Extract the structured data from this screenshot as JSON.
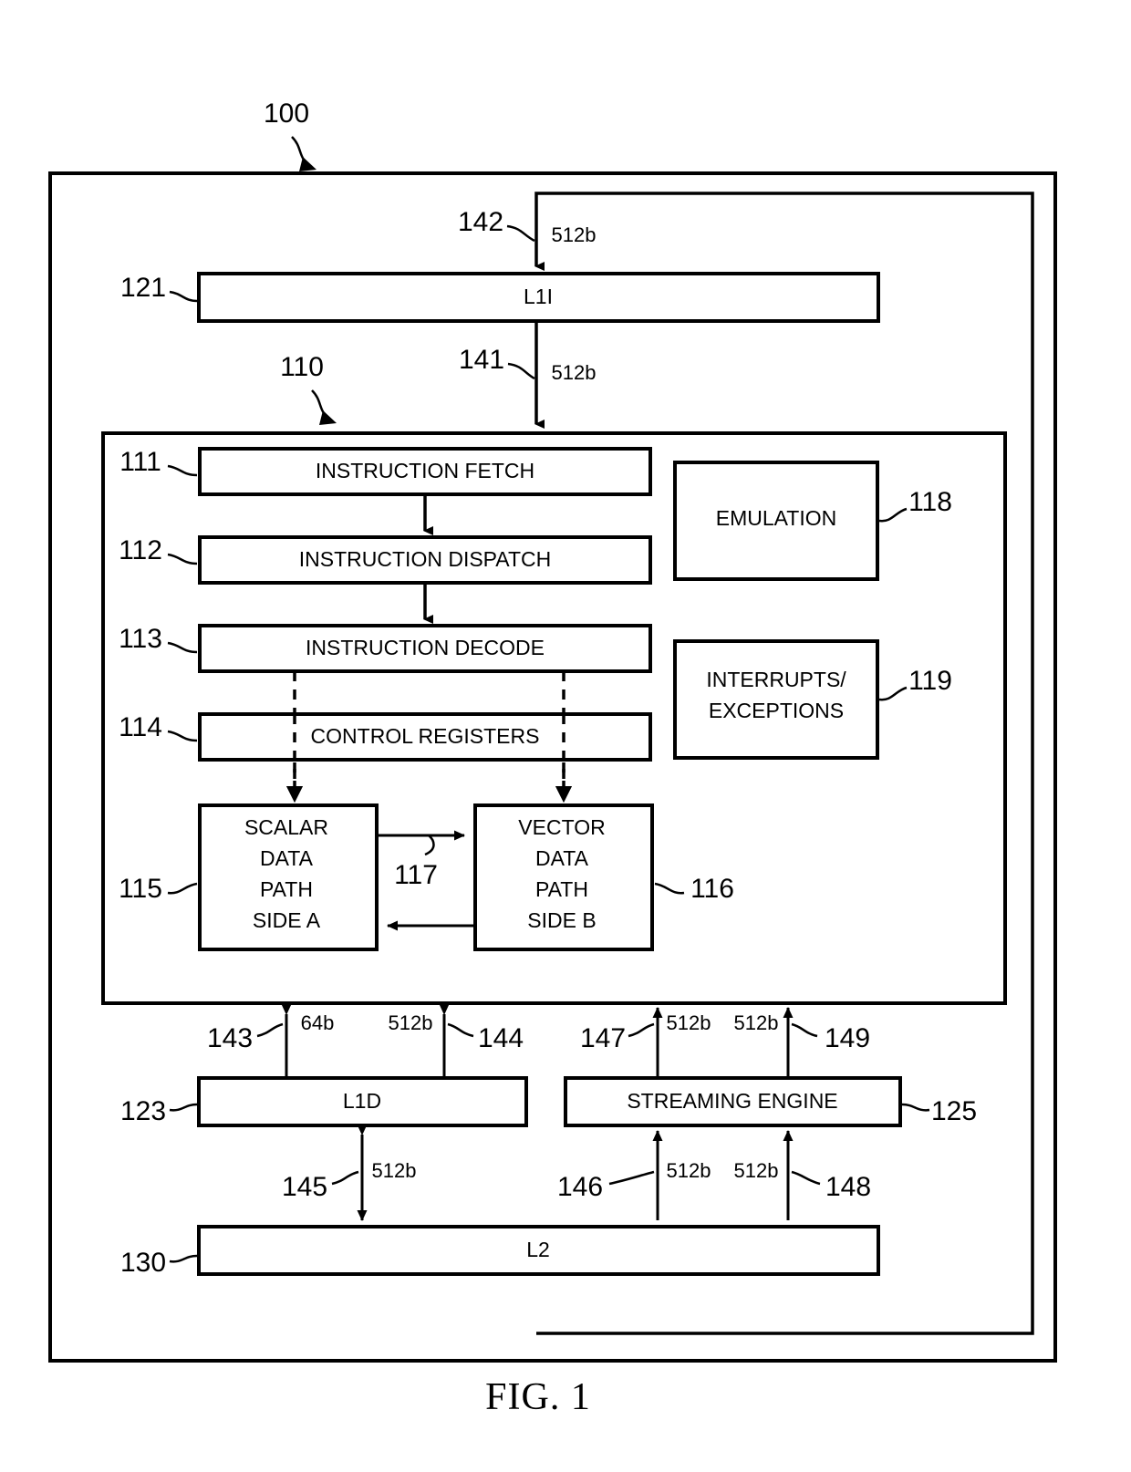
{
  "figure": {
    "caption": "FIG. 1",
    "system_ref": "100"
  },
  "blocks": {
    "l1i": {
      "label": "L1I",
      "ref": "121"
    },
    "cpu_core": {
      "ref": "110"
    },
    "instruction_fetch": {
      "label": "INSTRUCTION FETCH",
      "ref": "111"
    },
    "instruction_dispatch": {
      "label": "INSTRUCTION DISPATCH",
      "ref": "112"
    },
    "instruction_decode": {
      "label": "INSTRUCTION DECODE",
      "ref": "113"
    },
    "control_registers": {
      "label": "CONTROL REGISTERS",
      "ref": "114"
    },
    "scalar_data_path": {
      "label_lines": [
        "SCALAR",
        "DATA",
        "PATH",
        "SIDE A"
      ],
      "ref": "115"
    },
    "vector_data_path": {
      "label_lines": [
        "VECTOR",
        "DATA",
        "PATH",
        "SIDE B"
      ],
      "ref": "116"
    },
    "datapath_interconnect": {
      "ref": "117"
    },
    "emulation": {
      "label": "EMULATION",
      "ref": "118"
    },
    "interrupts_exceptions": {
      "label_lines": [
        "INTERRUPTS/",
        "EXCEPTIONS"
      ],
      "ref": "119"
    },
    "l1d": {
      "label": "L1D",
      "ref": "123"
    },
    "streaming_engine": {
      "label": "STREAMING ENGINE",
      "ref": "125"
    },
    "l2": {
      "label": "L2",
      "ref": "130"
    }
  },
  "buses": [
    {
      "ref": "141",
      "width": "512b"
    },
    {
      "ref": "142",
      "width": "512b"
    },
    {
      "ref": "143",
      "width": "64b"
    },
    {
      "ref": "144",
      "width": "512b"
    },
    {
      "ref": "145",
      "width": "512b"
    },
    {
      "ref": "146",
      "width": "512b"
    },
    {
      "ref": "147",
      "width": "512b"
    },
    {
      "ref": "148",
      "width": "512b"
    },
    {
      "ref": "149",
      "width": "512b"
    }
  ],
  "colors": {
    "line": "#000000",
    "background": "#ffffff",
    "fill": "#ffffff"
  }
}
